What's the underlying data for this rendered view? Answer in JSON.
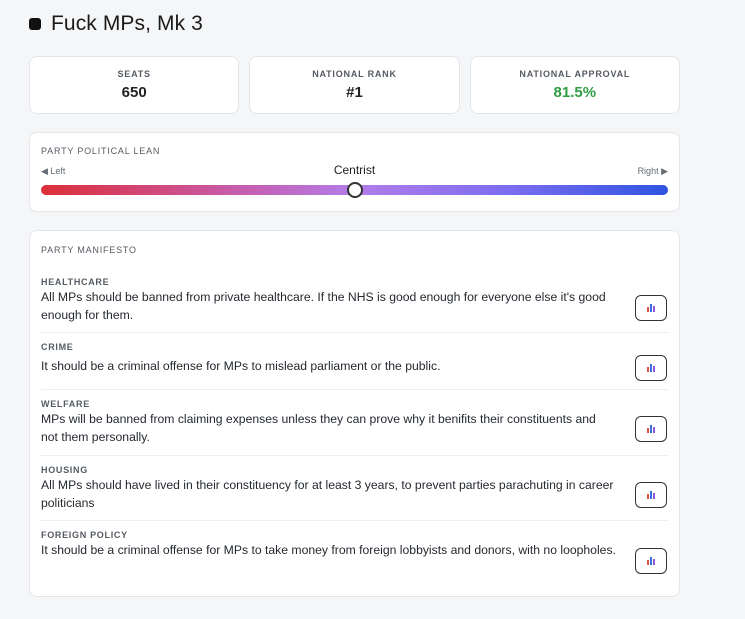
{
  "party": {
    "name": "Fuck MPs, Mk 3"
  },
  "stats": [
    {
      "label": "SEATS",
      "value": "650"
    },
    {
      "label": "NATIONAL RANK",
      "value": "#1"
    },
    {
      "label": "NATIONAL APPROVAL",
      "value": "81.5%",
      "color": "#2f9e44"
    }
  ],
  "lean": {
    "label": "PARTY POLITICAL LEAN",
    "left_label": "◀ Left",
    "right_label": "Right ▶",
    "position_label": "Centrist",
    "position_fraction": 0.5
  },
  "manifesto": {
    "label": "PARTY MANIFESTO",
    "policies": [
      {
        "category": "HEALTHCARE",
        "text": "All MPs should be banned from private healthcare. If the NHS is good enough for everyone else it's good enough for them.",
        "icon": "poll-chart-icon"
      },
      {
        "category": "CRIME",
        "text": "It should be a criminal offense for MPs to mislead parliament or the public.",
        "icon": "poll-chart-icon"
      },
      {
        "category": "WELFARE",
        "text": "MPs will be banned from claiming expenses unless they can prove why it benifits their constituents and not them personally.",
        "icon": "poll-chart-icon"
      },
      {
        "category": "HOUSING",
        "text": "All MPs should have lived in their constituency for at least 3 years, to prevent parties parachuting in career politicians",
        "icon": "poll-chart-icon"
      },
      {
        "category": "FOREIGN POLICY",
        "text": "It should be a criminal offense for MPs to take money from foreign lobbyists and donors, with no loopholes.",
        "icon": "poll-chart-icon"
      }
    ]
  }
}
